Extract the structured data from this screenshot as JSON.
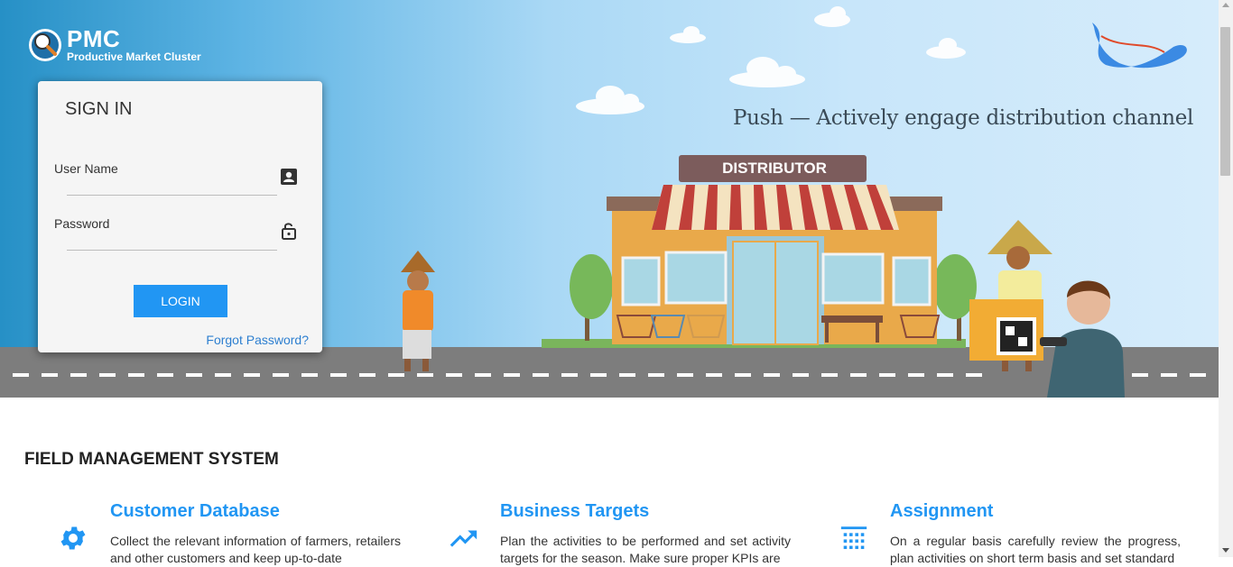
{
  "logo": {
    "title": "PMC",
    "subtitle": "Productive Market Cluster",
    "icon": "pmc-logo-icon"
  },
  "hero": {
    "tagline": "Push — Actively engage distribution channel",
    "store_sign": "DISTRIBUTOR"
  },
  "signin": {
    "title": "SIGN IN",
    "username_label": "User Name",
    "username_value": "",
    "password_label": "Password",
    "password_value": "",
    "login_button": "LOGIN",
    "forgot_link": "Forgot Password?",
    "username_icon": "contact-card-icon",
    "password_icon": "lock-open-icon"
  },
  "section": {
    "title": "FIELD MANAGEMENT SYSTEM"
  },
  "features": [
    {
      "title": "Customer Database",
      "description": "Collect the relevant information of farmers, retailers and other customers and keep up-to-date",
      "icon": "gear-icon"
    },
    {
      "title": "Business Targets",
      "description": "Plan the activities to be performed and set activity targets for the season. Make sure proper KPIs are",
      "icon": "trending-up-icon"
    },
    {
      "title": "Assignment",
      "description": "On a regular basis carefully review the progress, plan activities on short term basis and set standard",
      "icon": "calendar-grid-icon"
    }
  ],
  "colors": {
    "accent": "#2196f3",
    "hero_left": "#2690c6",
    "hero_right": "#d6ecfb",
    "road": "#7d7d7d"
  }
}
